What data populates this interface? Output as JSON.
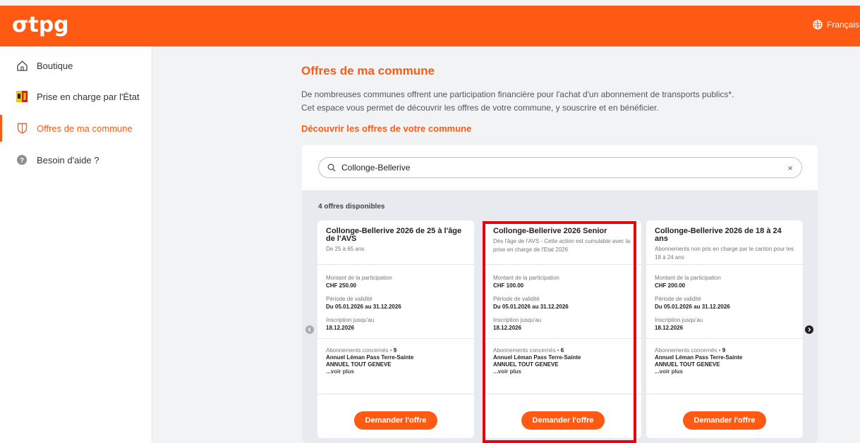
{
  "header": {
    "logo": "σtpg",
    "language": "Français /"
  },
  "sidebar": {
    "items": [
      {
        "label": "Boutique",
        "icon": "home-icon"
      },
      {
        "label": "Prise en charge par l'État",
        "icon": "geneva-flag-icon"
      },
      {
        "label": "Offres de ma commune",
        "icon": "shield-icon",
        "active": true
      },
      {
        "label": "Besoin d'aide ?",
        "icon": "help-icon"
      }
    ]
  },
  "main": {
    "title": "Offres de ma commune",
    "desc_line1": "De nombreuses communes offrent une participation financière pour l'achat d'un abonnement de transports publics*.",
    "desc_line2": "Cet espace vous permet de découvrir les offres de votre commune, y souscrire et en bénéficier.",
    "subtitle": "Découvrir les offres de votre commune",
    "search": {
      "value": "Collonge-Bellerive",
      "clear": "×"
    },
    "count": "4 offres disponibles",
    "labels": {
      "amount": "Montant de la participation",
      "validity": "Période de validité",
      "deadline": "Inscription jusqu'au",
      "subs": "Abonnements concernés • ",
      "more": "...voir plus",
      "button": "Demander l'offre"
    },
    "offers": [
      {
        "title": "Collonge-Bellerive 2026 de 25 à l'âge de l'AVS",
        "sub": "De 25 à 65 ans",
        "amount": "CHF 250.00",
        "validity": "Du 05.01.2026 au 31.12.2026",
        "deadline": "18.12.2026",
        "subs_count": "9",
        "sub1": "Annuel Léman Pass Terre-Sainte",
        "sub2": "ANNUEL TOUT GENEVE"
      },
      {
        "title": "Collonge-Bellerive 2026 Senior",
        "sub": "Dès l'âge de l'AVS - Cette action est cumulable avec la prise en charge de l'Etat 2026",
        "amount": "CHF 100.00",
        "validity": "Du 05.01.2026 au 31.12.2026",
        "deadline": "18.12.2026",
        "subs_count": "6",
        "sub1": "Annuel Léman Pass Terre-Sainte",
        "sub2": "ANNUEL TOUT GENEVE"
      },
      {
        "title": "Collonge-Bellerive 2026 de 18 à 24 ans",
        "sub": "Abonnements non pris en charge par le canton pour les 18 à 24 ans",
        "amount": "CHF 200.00",
        "validity": "Du 05.01.2026 au 31.12.2026",
        "deadline": "18.12.2026",
        "subs_count": "9",
        "sub1": "Annuel Léman Pass Terre-Sainte",
        "sub2": "ANNUEL TOUT GENEVE"
      }
    ]
  },
  "colors": {
    "brand": "#ff5a14",
    "highlight": "#e8000b"
  }
}
